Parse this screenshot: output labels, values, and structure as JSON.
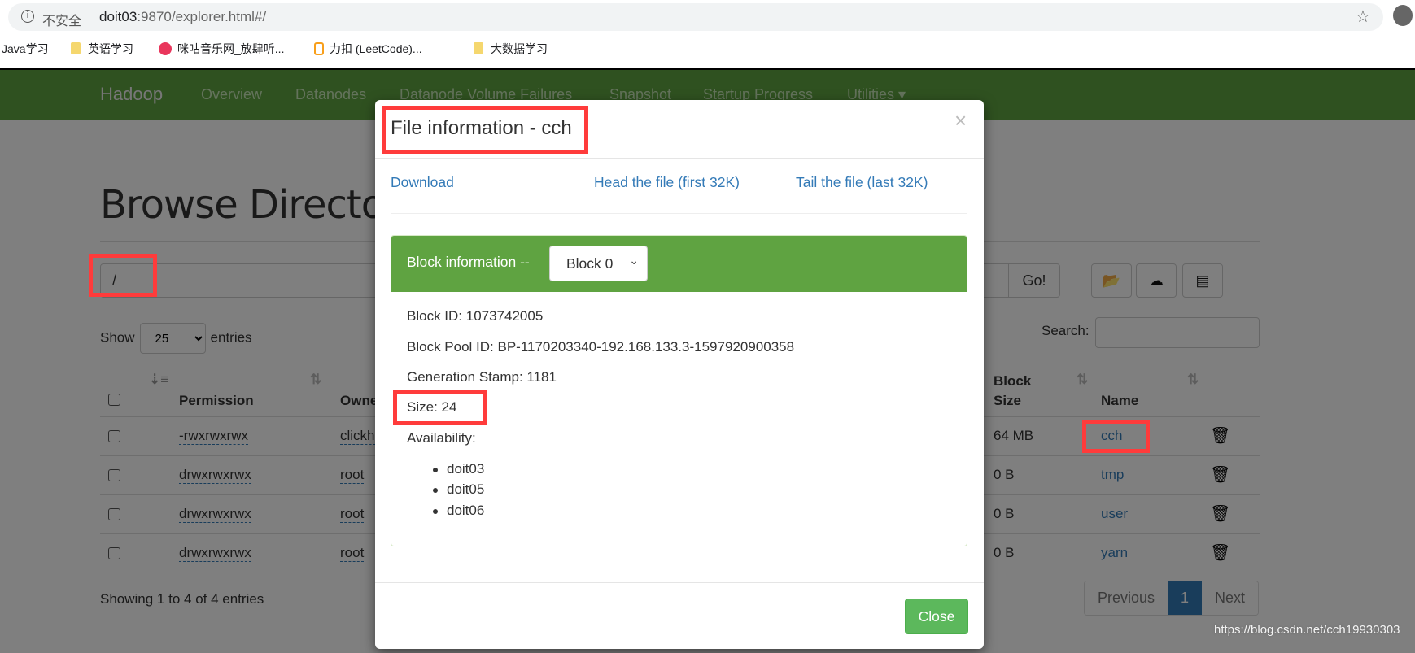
{
  "browser": {
    "security_label": "不安全",
    "url_host": "doit03",
    "url_rest": ":9870/explorer.html#/",
    "bookmarks": [
      {
        "label": "Java学习",
        "icon": "none"
      },
      {
        "label": "英语学习",
        "icon": "folder-icon"
      },
      {
        "label": "咪咕音乐网_放肆听...",
        "icon": "migu-icon"
      },
      {
        "label": "力扣 (LeetCode)...",
        "icon": "leetcode-icon"
      },
      {
        "label": "大数据学习",
        "icon": "folder-icon"
      }
    ]
  },
  "navbar": {
    "brand": "Hadoop",
    "items": [
      "Overview",
      "Datanodes",
      "Datanode Volume Failures",
      "Snapshot",
      "Startup Progress",
      "Utilities ▾"
    ],
    "color": "#5fa341"
  },
  "page": {
    "heading": "Browse Directory",
    "path_value": "/",
    "go_label": "Go!",
    "show_label": "Show",
    "entries_value": "25",
    "entries_label": "entries",
    "search_label": "Search:",
    "columns": {
      "permission": "Permission",
      "owner": "Owner",
      "block_size_1": "Block",
      "block_size_2": "Size",
      "name": "Name"
    },
    "rows": [
      {
        "permission": "-rwxrwxrwx",
        "owner": "clickhouse",
        "block_size": "64 MB",
        "name": "cch"
      },
      {
        "permission": "drwxrwxrwx",
        "owner": "root",
        "block_size": "0 B",
        "name": "tmp"
      },
      {
        "permission": "drwxrwxrwx",
        "owner": "root",
        "block_size": "0 B",
        "name": "user"
      },
      {
        "permission": "drwxrwxrwx",
        "owner": "root",
        "block_size": "0 B",
        "name": "yarn"
      }
    ],
    "showing": "Showing 1 to 4 of 4 entries",
    "pagination": {
      "previous": "Previous",
      "current": "1",
      "next": "Next"
    }
  },
  "modal": {
    "title": "File information - cch",
    "close_x": "×",
    "links": {
      "download": "Download",
      "head": "Head the file (first 32K)",
      "tail": "Tail the file (last 32K)"
    },
    "block_header": "Block information --",
    "block_select": "Block 0",
    "block_id": "Block ID: 1073742005",
    "block_pool_id": "Block Pool ID: BP-1170203340-192.168.133.3-1597920900358",
    "generation_stamp": "Generation Stamp: 1181",
    "size": "Size: 24",
    "availability": "Availability:",
    "nodes": [
      "doit03",
      "doit05",
      "doit06"
    ],
    "close_label": "Close"
  },
  "watermark": "https://blog.csdn.net/cch19930303",
  "colors": {
    "accent_green": "#5fa341",
    "link": "#337ab7",
    "annotation_red": "#ff3b3b",
    "close_button": "#5cb85c"
  }
}
